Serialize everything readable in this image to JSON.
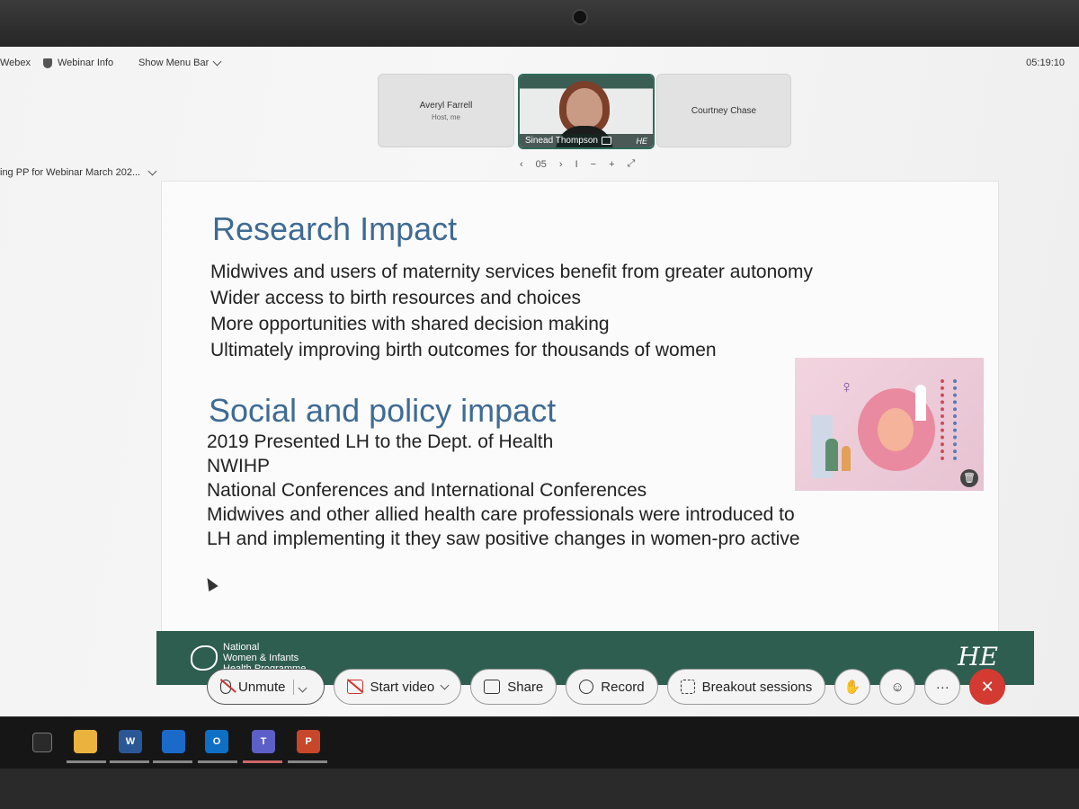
{
  "topbar": {
    "app": "Webex",
    "webinar_info": "Webinar Info",
    "show_menu_bar": "Show Menu Bar",
    "clock": "05:19:10"
  },
  "participants": [
    {
      "name": "Averyl Farrell",
      "role": "Host, me"
    },
    {
      "name": "Sinead Thompson"
    },
    {
      "name": "Courtney Chase"
    }
  ],
  "document": {
    "title": "ing PP for Webinar March 202..."
  },
  "slide_nav": {
    "page": "05",
    "separator": "I",
    "zoom_out": "−",
    "zoom_in": "+"
  },
  "slide": {
    "heading1": "Research Impact",
    "lines1": [
      "Midwives and users of maternity services benefit from greater autonomy",
      "Wider access to birth resources and choices",
      "More opportunities with shared decision making",
      "Ultimately improving birth outcomes for thousands of women"
    ],
    "heading2": "Social and policy impact",
    "lines2": [
      "2019 Presented LH to the Dept. of Health",
      "NWIHP",
      "National Conferences and International Conferences",
      "Midwives and other allied health care professionals were introduced to",
      "LH and implementing it they saw positive changes in women-pro active"
    ],
    "footer_org": [
      "National",
      "Women & Infants",
      "Health Programme"
    ],
    "footer_brand": "HSE"
  },
  "controls": {
    "unmute": "Unmute",
    "start_video": "Start video",
    "share": "Share",
    "record": "Record",
    "breakout": "Breakout sessions",
    "more": "···",
    "end": "✕"
  },
  "taskbar": {
    "word": "W",
    "outlook": "O",
    "teams": "T",
    "ppt": "P"
  },
  "colors": {
    "heading": "#3f6b94",
    "footer": "#2e5e50",
    "end_call": "#d23a32"
  }
}
